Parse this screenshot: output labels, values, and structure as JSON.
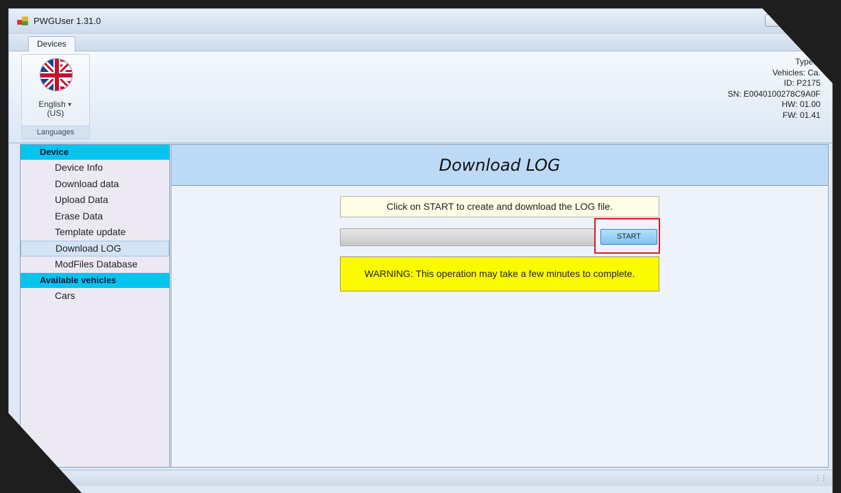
{
  "window": {
    "title": "PWGUser 1.31.0"
  },
  "tabs": [
    {
      "label": "Devices",
      "selected": true
    }
  ],
  "ribbon": {
    "language_button_label": "English (US)",
    "language_button_line1": "English",
    "language_button_line2": "(US)",
    "language_group_title": "Languages",
    "flag_icon": "uk-flag-icon"
  },
  "device_info": {
    "type": "Type: (",
    "vehicles": "Vehicles: Ca.",
    "id": "ID: P2175",
    "sn": "SN: E0040100278C9A0F",
    "hw": "HW: 01.00",
    "fw": "FW: 01.41"
  },
  "sidebar": {
    "sections": [
      {
        "header": "Device",
        "items": [
          {
            "label": "Device Info",
            "selected": false
          },
          {
            "label": "Download data",
            "selected": false
          },
          {
            "label": "Upload Data",
            "selected": false
          },
          {
            "label": "Erase Data",
            "selected": false
          },
          {
            "label": "Template update",
            "selected": false
          },
          {
            "label": "Download LOG",
            "selected": true
          },
          {
            "label": "ModFiles Database",
            "selected": false
          }
        ]
      },
      {
        "header": "Available vehicles",
        "items": [
          {
            "label": "Cars",
            "selected": false
          }
        ]
      }
    ]
  },
  "main": {
    "title": "Download LOG",
    "info_text": "Click on START to create and download the LOG file.",
    "progress_fraction": 0,
    "start_button_label": "START",
    "warning_text": "WARNING: This operation may take a few minutes to complete."
  },
  "colors": {
    "sidebar_header": "#07c4ef",
    "warning_background": "#fafa00",
    "highlight_border": "#e0151c",
    "start_button": "#7dc3ef"
  }
}
